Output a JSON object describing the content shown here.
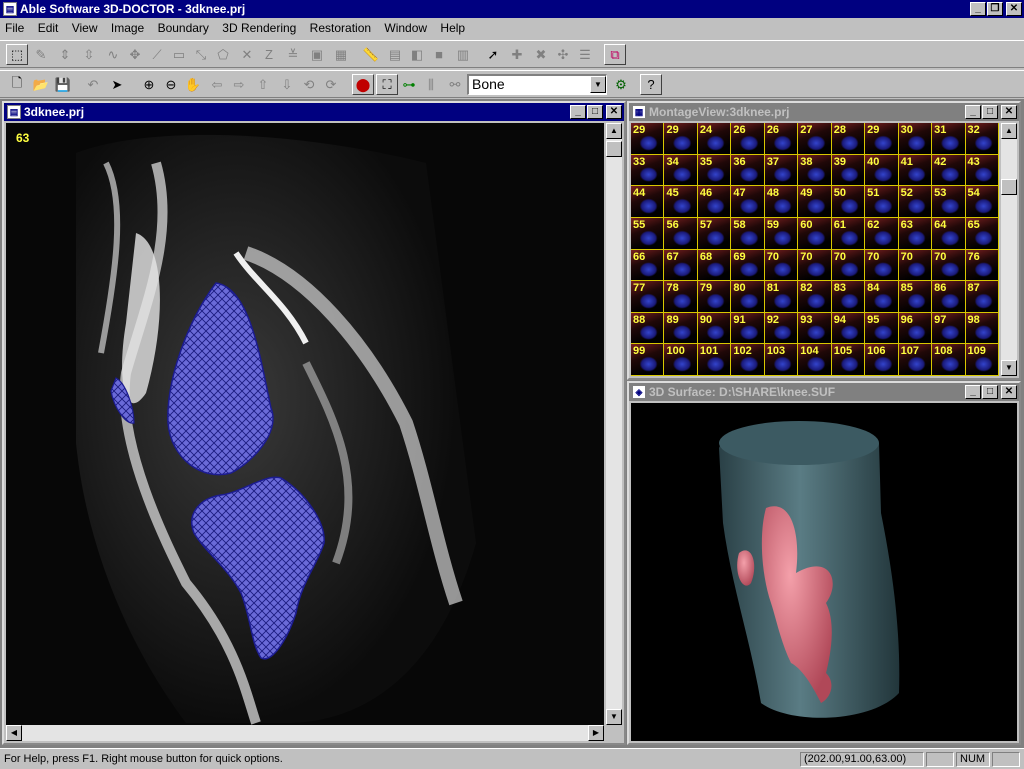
{
  "app": {
    "title": "Able Software 3D-DOCTOR - 3dknee.prj",
    "icon": "app-document-icon"
  },
  "menu": [
    {
      "label": "File"
    },
    {
      "label": "Edit"
    },
    {
      "label": "View"
    },
    {
      "label": "Image"
    },
    {
      "label": "Boundary"
    },
    {
      "label": "3D Rendering"
    },
    {
      "label": "Restoration"
    },
    {
      "label": "Window"
    },
    {
      "label": "Help"
    }
  ],
  "toolbar": {
    "material_select": "Bone"
  },
  "image_window": {
    "title": "3dknee.prj",
    "slice_number": "63"
  },
  "montage_window": {
    "title": "MontageView:3dknee.prj",
    "slices": [
      "29",
      "29",
      "24",
      "26",
      "26",
      "27",
      "28",
      "29",
      "30",
      "31",
      "32",
      "33",
      "34",
      "35",
      "36",
      "37",
      "38",
      "39",
      "40",
      "41",
      "42",
      "43",
      "44",
      "45",
      "46",
      "47",
      "48",
      "49",
      "50",
      "51",
      "52",
      "53",
      "54",
      "55",
      "56",
      "57",
      "58",
      "59",
      "60",
      "61",
      "62",
      "63",
      "64",
      "65",
      "66",
      "67",
      "68",
      "69",
      "70",
      "70",
      "70",
      "70",
      "70",
      "70",
      "76",
      "77",
      "78",
      "79",
      "80",
      "81",
      "82",
      "83",
      "84",
      "85",
      "86",
      "87",
      "88",
      "89",
      "90",
      "91",
      "92",
      "93",
      "94",
      "95",
      "96",
      "97",
      "98",
      "99",
      "100",
      "101",
      "102",
      "103",
      "104",
      "105",
      "106",
      "107",
      "108",
      "109"
    ]
  },
  "surface_window": {
    "title": "3D Surface: D:\\SHARE\\knee.SUF"
  },
  "status": {
    "help_text": "For Help, press F1.  Right mouse button for quick options.",
    "coords": "(202.00,91.00,63.00)",
    "num": "NUM"
  },
  "colors": {
    "titlebar": "#000080",
    "boundary": "#2020c0",
    "surface": "#4a6a70",
    "bone": "#e06a78"
  }
}
